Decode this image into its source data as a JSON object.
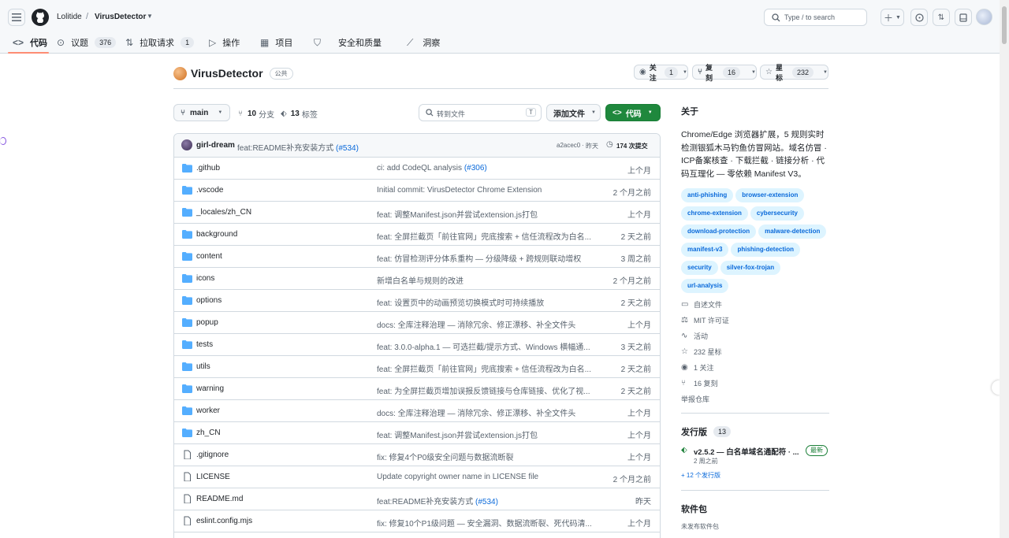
{
  "header": {
    "owner": "Lolitide",
    "repo": "VirusDetector",
    "search_placeholder": "Type / to search",
    "search_key": "/"
  },
  "nav": {
    "code": "代码",
    "issues": "议题",
    "issues_count": "376",
    "pulls": "拉取请求",
    "pulls_count": "1",
    "actions": "操作",
    "projects": "项目",
    "security": "安全和质量",
    "insights": "洞察"
  },
  "repo": {
    "name": "VirusDetector",
    "visibility": "公共",
    "watch_label": "关注",
    "watch_count": "1",
    "fork_label": "复刻",
    "fork_count": "16",
    "star_label": "星标",
    "star_count": "232"
  },
  "toolbar": {
    "branch": "main",
    "branches_count": "10",
    "branches_label": "分支",
    "tags_count": "13",
    "tags_label": "标签",
    "goto_file": "转到文件",
    "goto_key": "T",
    "add_file": "添加文件",
    "code_button": "代码"
  },
  "latest_commit": {
    "author": "girl-dream",
    "message": "feat:README补充安装方式",
    "pr": "(#534)",
    "sha": "a2acec0",
    "sep": "·",
    "date": "昨天",
    "commits": "174 次提交"
  },
  "files": [
    {
      "type": "dir",
      "name": ".github",
      "msg": "ci: add CodeQL analysis",
      "pr": "(#306)",
      "date": "上个月"
    },
    {
      "type": "dir",
      "name": ".vscode",
      "msg": "Initial commit: VirusDetector Chrome Extension",
      "pr": "",
      "date": "2 个月之前"
    },
    {
      "type": "dir",
      "name": "_locales/zh_CN",
      "msg": "feat: 调整Manifest.json并尝试extension.js打包",
      "pr": "",
      "date": "上个月"
    },
    {
      "type": "dir",
      "name": "background",
      "msg": "feat: 全屏拦截页「前往官网」兜底搜索 + 信任流程改为白名...",
      "pr": "",
      "date": "2 天之前"
    },
    {
      "type": "dir",
      "name": "content",
      "msg": "feat: 仿冒检测评分体系重构 — 分级降级 + 跨规则联动增权",
      "pr": "",
      "date": "3 周之前"
    },
    {
      "type": "dir",
      "name": "icons",
      "msg": "新增白名单与规则的改进",
      "pr": "",
      "date": "2 个月之前"
    },
    {
      "type": "dir",
      "name": "options",
      "msg": "feat: 设置页中的动画预览切换模式时可持续播放",
      "pr": "",
      "date": "2 天之前"
    },
    {
      "type": "dir",
      "name": "popup",
      "msg": "docs: 全库注释治理 — 消除冗余、修正漂移、补全文件头",
      "pr": "",
      "date": "上个月"
    },
    {
      "type": "dir",
      "name": "tests",
      "msg": "feat: 3.0.0-alpha.1 — 可选拦截/提示方式、Windows 横幅通...",
      "pr": "",
      "date": "3 天之前"
    },
    {
      "type": "dir",
      "name": "utils",
      "msg": "feat: 全屏拦截页「前往官网」兜底搜索 + 信任流程改为白名...",
      "pr": "",
      "date": "2 天之前"
    },
    {
      "type": "dir",
      "name": "warning",
      "msg": "feat: 为全屏拦截页增加误报反馈链接与仓库链接、优化了视...",
      "pr": "",
      "date": "2 天之前"
    },
    {
      "type": "dir",
      "name": "worker",
      "msg": "docs: 全库注释治理 — 消除冗余、修正漂移、补全文件头",
      "pr": "",
      "date": "上个月"
    },
    {
      "type": "dir",
      "name": "zh_CN",
      "msg": "feat: 调整Manifest.json并尝试extension.js打包",
      "pr": "",
      "date": "上个月"
    },
    {
      "type": "file",
      "name": ".gitignore",
      "msg": "fix: 修复4个P0级安全问题与数据流断裂",
      "pr": "",
      "date": "上个月"
    },
    {
      "type": "file",
      "name": "LICENSE",
      "msg": "Update copyright owner name in LICENSE file",
      "pr": "",
      "date": "2 个月之前"
    },
    {
      "type": "file",
      "name": "README.md",
      "msg": "feat:README补充安装方式",
      "pr": "(#534)",
      "date": "昨天"
    },
    {
      "type": "file",
      "name": "eslint.config.mjs",
      "msg": "fix: 修复10个P1级问题 — 安全漏洞、数据流断裂、死代码清...",
      "pr": "",
      "date": "上个月"
    }
  ],
  "about": {
    "title": "关于",
    "description": "Chrome/Edge 浏览器扩展，5 规则实时检测银狐木马钓鱼仿冒网站。域名仿冒 · ICP备案核查 · 下载拦截 · 链接分析 · 代码互理化 — 零依赖 Manifest V3。",
    "topics": [
      "anti-phishing",
      "browser-extension",
      "chrome-extension",
      "cybersecurity",
      "download-protection",
      "malware-detection",
      "manifest-v3",
      "phishing-detection",
      "security",
      "silver-fox-trojan",
      "url-analysis"
    ],
    "readme": "自述文件",
    "license": "MIT 许可证",
    "activity": "活动",
    "stars": "232 星标",
    "watchers": "1 关注",
    "forks": "16 复刻",
    "report": "举报仓库"
  },
  "releases": {
    "title": "发行版",
    "count": "13",
    "latest_name": "v2.5.2 — 白名单域名通配符 · ...",
    "latest_badge": "最新",
    "latest_date": "2 周之前",
    "more": "+ 12 个发行版"
  },
  "packages": {
    "title": "软件包",
    "empty": "未发布软件包"
  }
}
